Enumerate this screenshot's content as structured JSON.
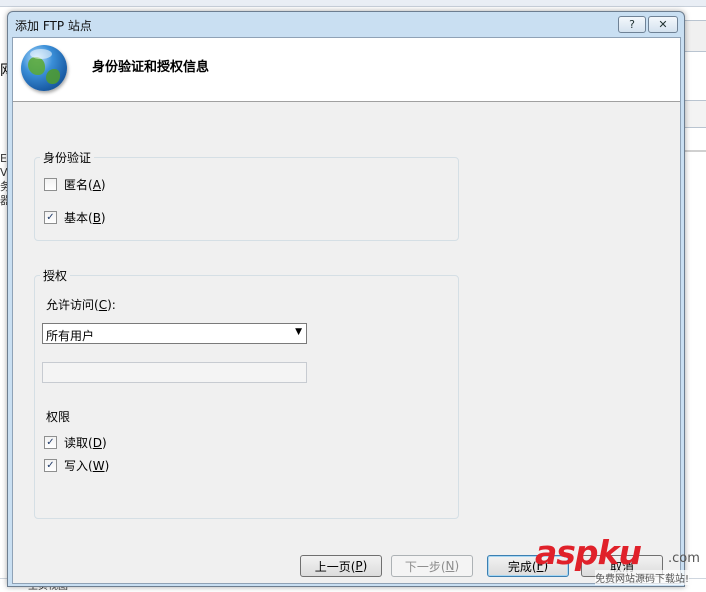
{
  "dialog": {
    "title": "添加 FTP 站点",
    "help_label": "?",
    "close_label": "✕",
    "header_title": "身份验证和授权信息"
  },
  "authentication": {
    "legend": "身份验证",
    "anonymous": {
      "label_prefix": "匿名(",
      "mnemonic": "A",
      "label_suffix": ")",
      "checked": false
    },
    "basic": {
      "label_prefix": "基本(",
      "mnemonic": "B",
      "label_suffix": ")",
      "checked": true
    }
  },
  "authorization": {
    "legend": "授权",
    "allow_access_label_prefix": "允许访问(",
    "allow_access_mnemonic": "C",
    "allow_access_label_suffix": "):",
    "allow_access_value": "所有用户",
    "permissions_title": "权限",
    "read": {
      "label_prefix": "读取(",
      "mnemonic": "D",
      "label_suffix": ")",
      "checked": true
    },
    "write": {
      "label_prefix": "写入(",
      "mnemonic": "W",
      "label_suffix": ")",
      "checked": true
    }
  },
  "buttons": {
    "prev": {
      "label_prefix": "上一页(",
      "mnemonic": "P",
      "label_suffix": ")"
    },
    "next": {
      "label_prefix": "下一步(",
      "mnemonic": "N",
      "label_suffix": ")"
    },
    "finish": {
      "label_prefix": "完成(",
      "mnemonic": "F",
      "label_suffix": ")"
    },
    "cancel": {
      "label": "取消"
    }
  },
  "watermark": {
    "brand": "aspku",
    "domain": ".com",
    "slogan": "免费网站源码下载站!"
  },
  "background": {
    "left_glyph_1": "网",
    "left_glyph_2": "E V\n务器",
    "bottom_text": "主页视图"
  }
}
